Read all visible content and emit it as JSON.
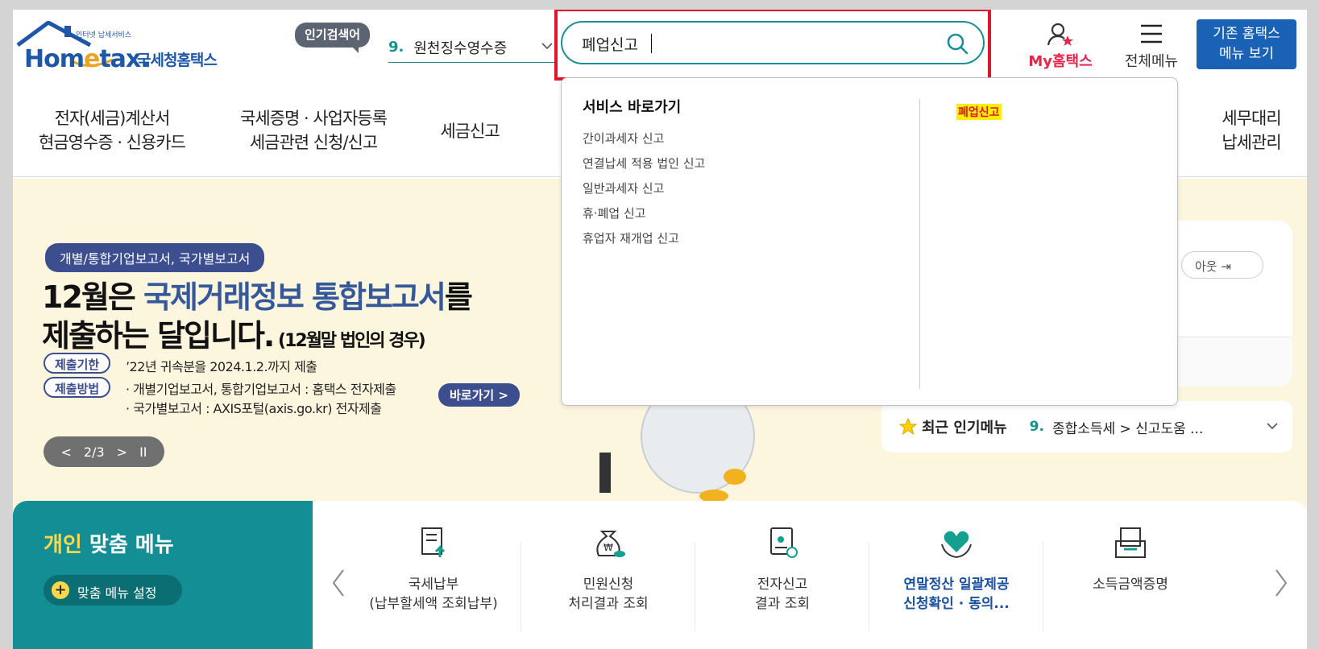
{
  "header": {
    "logo_tagline": "인터넷 납세서비스",
    "logo_brand_a": "Hom",
    "logo_brand_b": "e",
    "logo_brand_c": "tax.",
    "logo_korean": "국세청홈택스",
    "popular_badge": "인기검색어",
    "popular_rank": "9.",
    "popular_term": "원천징수영수증",
    "search_value": "폐업신고",
    "my_hometax": "My홈택스",
    "all_menu": "전체메뉴",
    "legacy_line1": "기존 홈택스",
    "legacy_line2": "메뉴 보기"
  },
  "nav": [
    {
      "l1": "전자(세금)계산서",
      "l2": "현금영수증 · 신용카드"
    },
    {
      "l1": "국세증명 · 사업자등록",
      "l2": "세금관련 신청/신고"
    },
    {
      "l1": "세금신고",
      "l2": ""
    },
    {
      "l1": "세무대리",
      "l2": "납세관리"
    }
  ],
  "banner": {
    "category": "개별/통합기업보고서, 국가별보고서",
    "title1_a": "12월은 ",
    "title1_hl": "국제거래정보 통합보고서",
    "title1_b": "를",
    "title2": "제출하는 달입니다.",
    "title2_small": " (12월말 법인의 경우)",
    "tag_deadline": "제출기한",
    "deadline_text": "’22년 귀속분을 2024.1.2.까지 제출",
    "tag_method": "제출방법",
    "method_line1": "· 개별기업보고서, 통합기업보고서 : 홈택스 전자제출",
    "method_line2": "· 국가별보고서 : AXIS포털(axis.go.kr) 전자제출",
    "go_button": "바로가기 >",
    "pager_prev": "<",
    "pager_text": "2/3",
    "pager_next": ">",
    "pager_pause": "II"
  },
  "login_card": {
    "logout": "아웃"
  },
  "popular_menu": {
    "label": "최근 인기메뉴",
    "rank": "9.",
    "text": "종합소득세 > 신고도움 ..."
  },
  "personal": {
    "title_a": "개인",
    "title_b": " 맞춤 메뉴",
    "setting": "맞춤 메뉴 설정"
  },
  "quick": [
    {
      "l1": "국세납부",
      "l2": "(납부할세액 조회납부)"
    },
    {
      "l1": "민원신청",
      "l2": "처리결과 조회"
    },
    {
      "l1": "전자신고",
      "l2": "결과 조회"
    },
    {
      "l1": "연말정산 일괄제공",
      "l2": "신청확인 · 동의..."
    },
    {
      "l1": "소득금액증명",
      "l2": ""
    }
  ],
  "dropdown": {
    "heading": "서비스 바로가기",
    "items": [
      "간이과세자 신고",
      "연결납세 적용 법인 신고",
      "일반과세자 신고",
      "휴·폐업 신고",
      "휴업자 재개업 신고"
    ],
    "keyword": "폐업신고"
  },
  "colors": {
    "accent_teal": "#138e94",
    "brand_blue": "#1a62b5",
    "highlight_red": "#e0142a"
  }
}
